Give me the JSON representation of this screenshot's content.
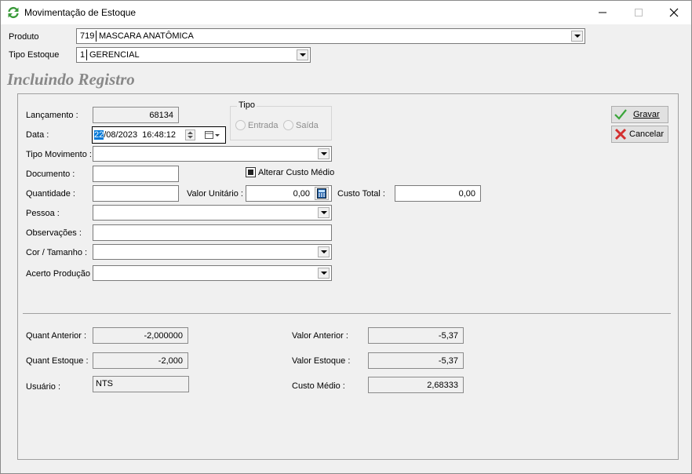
{
  "window": {
    "title": "Movimentação de Estoque"
  },
  "top": {
    "produto_label": "Produto",
    "produto_code": "719",
    "produto_name": "MASCARA ANATÔMICA",
    "tipo_estoque_label": "Tipo Estoque",
    "tipo_estoque_code": "1",
    "tipo_estoque_name": "GERENCIAL"
  },
  "heading": "Incluindo Registro",
  "form": {
    "lancamento_label": "Lançamento :",
    "lancamento_value": "68134",
    "data_label": "Data :",
    "data_day": "22",
    "data_rest": "/08/2023  16:48:12",
    "tipo_group_label": "Tipo",
    "tipo_entrada": "Entrada",
    "tipo_saida": "Saída",
    "tipo_movimento_label": "Tipo Movimento :",
    "documento_label": "Documento :",
    "alterar_custo_label": "Alterar Custo Médio",
    "quantidade_label": "Quantidade :",
    "valor_unitario_label": "Valor Unitário :",
    "valor_unitario_value": "0,00",
    "custo_total_label": "Custo Total :",
    "custo_total_value": "0,00",
    "pessoa_label": "Pessoa :",
    "observacoes_label": "Observações :",
    "cor_tamanho_label": "Cor / Tamanho :",
    "acerto_producao_label": "Acerto Produção"
  },
  "buttons": {
    "gravar": "Gravar",
    "cancelar": "Cancelar"
  },
  "summary": {
    "quant_anterior_label": "Quant Anterior :",
    "quant_anterior_value": "-2,000000",
    "quant_estoque_label": "Quant Estoque :",
    "quant_estoque_value": "-2,000",
    "usuario_label": "Usuário :",
    "usuario_value": "NTS",
    "valor_anterior_label": "Valor Anterior :",
    "valor_anterior_value": "-5,37",
    "valor_estoque_label": "Valor Estoque :",
    "valor_estoque_value": "-5,37",
    "custo_medio_label": "Custo Médio :",
    "custo_medio_value": "2,68333"
  },
  "colors": {
    "heading": "#888888",
    "selection": "#0078d7",
    "gravar_check": "#3aa53a",
    "cancelar_x": "#d32f2f",
    "refresh_icon": "#3a9a3a"
  }
}
